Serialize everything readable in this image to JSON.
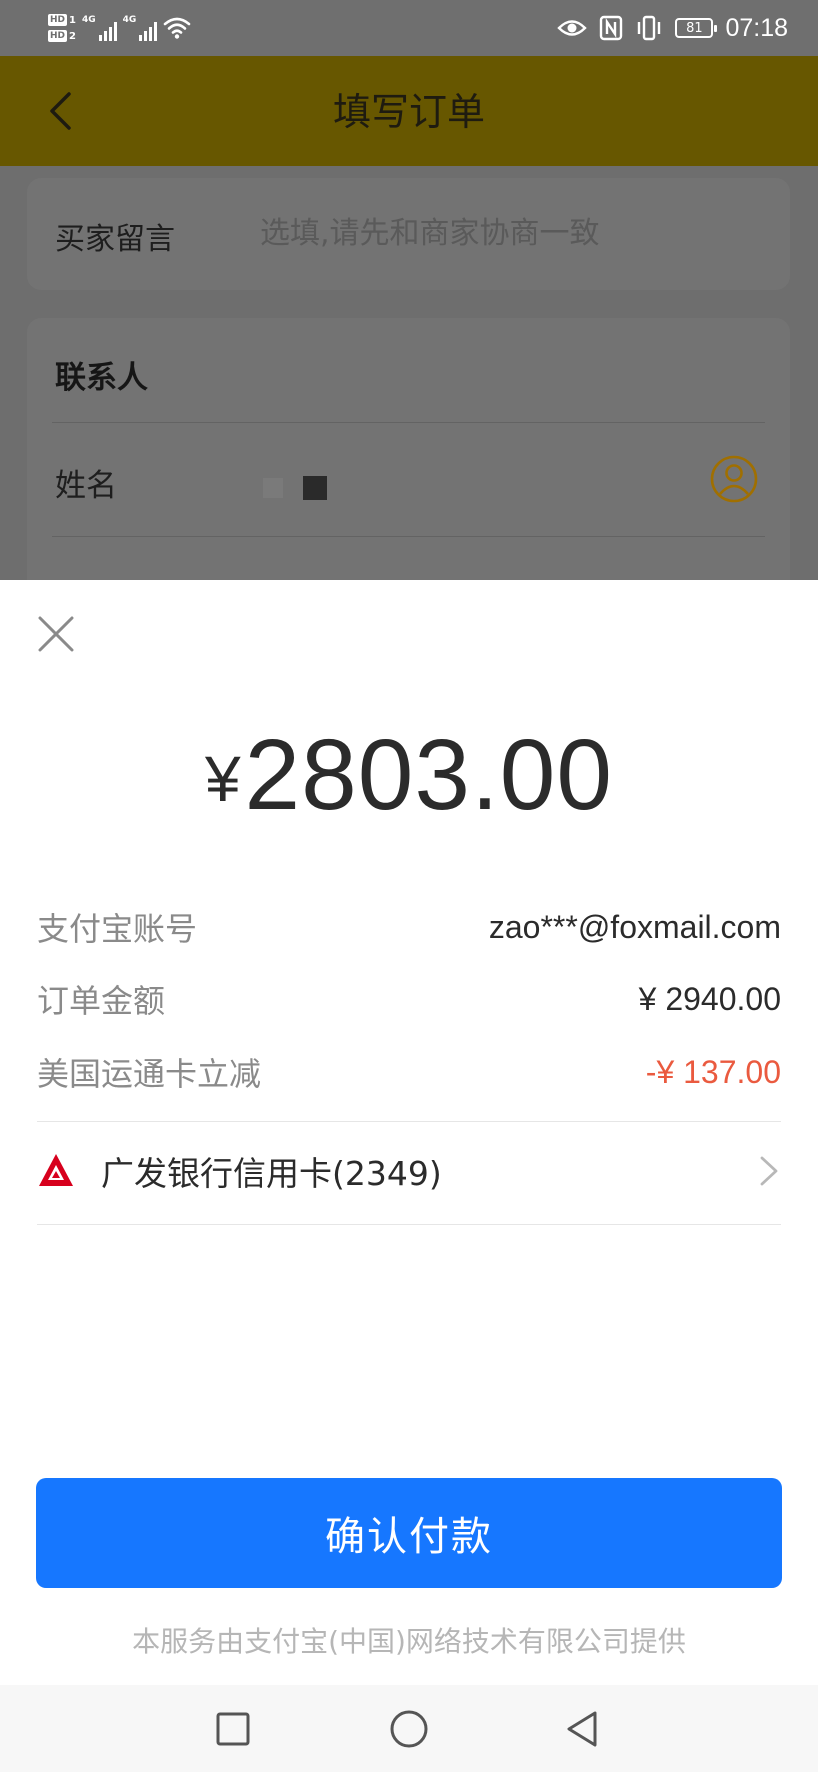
{
  "status_bar": {
    "hd1": "HD",
    "hd1_num": "1",
    "hd2": "HD",
    "hd2_num": "2",
    "net1": "4G",
    "net2": "4G",
    "battery": "81",
    "time": "07:18",
    "icons": [
      "wifi-icon",
      "eye-icon",
      "nfc-icon",
      "vibrate-icon",
      "battery-icon"
    ]
  },
  "header": {
    "title": "填写订单",
    "back_icon": "back-arrow-icon"
  },
  "message_card": {
    "label": "买家留言",
    "placeholder": "选填,请先和商家协商一致"
  },
  "contact_card": {
    "title": "联系人",
    "name_label": "姓名",
    "contact_icon": "person-circle-icon"
  },
  "payment_sheet": {
    "currency_symbol": "¥",
    "amount": "2803.00",
    "rows": [
      {
        "label": "支付宝账号",
        "value": "zao***@foxmail.com"
      },
      {
        "label": "订单金额",
        "value": "¥ 2940.00"
      },
      {
        "label": "美国运通卡立减",
        "value": "-¥ 137.00"
      }
    ],
    "payment_method": "广发银行信用卡(2349)",
    "confirm_label": "确认付款",
    "provider_note": "本服务由支付宝(中国)网络技术有限公司提供"
  },
  "colors": {
    "primary_button": "#1677ff",
    "discount_red": "#ea5a3f",
    "header_dimmed": "#675700",
    "bank_logo": "#d7001d"
  }
}
